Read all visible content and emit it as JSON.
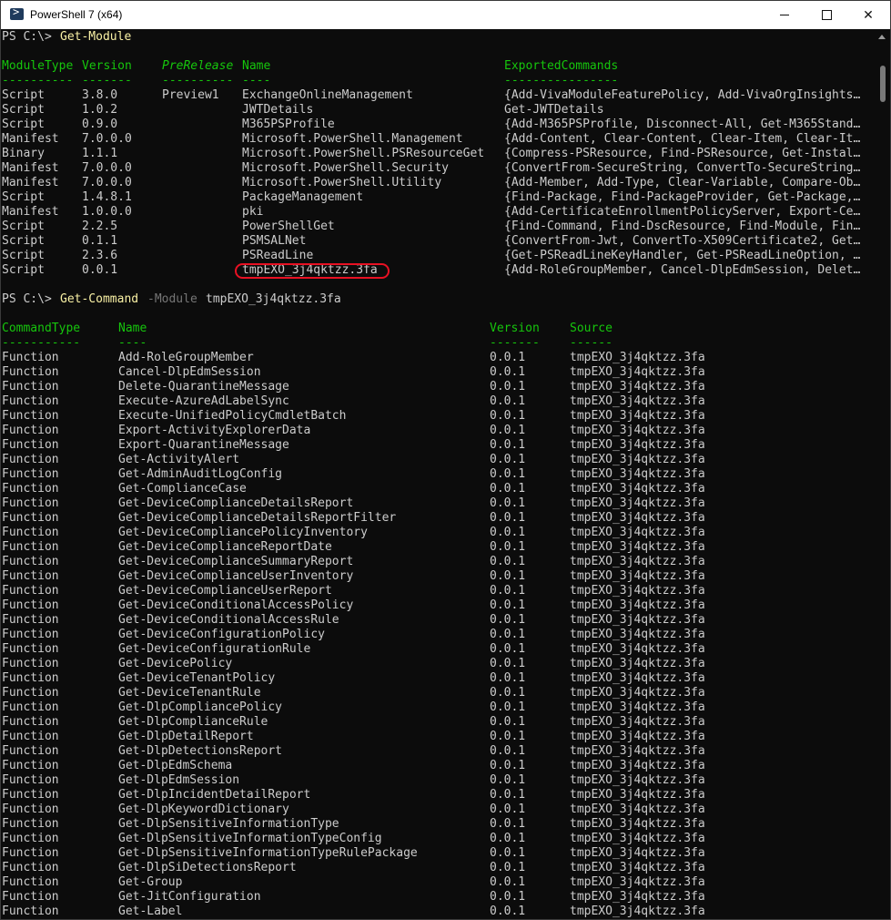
{
  "window": {
    "title": "PowerShell 7 (x64)"
  },
  "session": {
    "prompt": "PS C:\\> ",
    "command1": {
      "name": "Get-Module"
    },
    "command2": {
      "name": "Get-Command",
      "param": "-Module",
      "arg": "tmpEXO_3j4qktzz.3fa"
    }
  },
  "modules": {
    "headers": [
      "ModuleType",
      "Version",
      "PreRelease",
      "Name",
      "ExportedCommands"
    ],
    "underlines": [
      "----------",
      "-------",
      "----------",
      "----",
      "----------------"
    ],
    "rows": [
      [
        "Script",
        "3.8.0",
        "Preview1",
        "ExchangeOnlineManagement",
        "{Add-VivaModuleFeaturePolicy, Add-VivaOrgInsights…"
      ],
      [
        "Script",
        "1.0.2",
        "",
        "JWTDetails",
        "Get-JWTDetails"
      ],
      [
        "Script",
        "0.9.0",
        "",
        "M365PSProfile",
        "{Add-M365PSProfile, Disconnect-All, Get-M365Stand…"
      ],
      [
        "Manifest",
        "7.0.0.0",
        "",
        "Microsoft.PowerShell.Management",
        "{Add-Content, Clear-Content, Clear-Item, Clear-It…"
      ],
      [
        "Binary",
        "1.1.1",
        "",
        "Microsoft.PowerShell.PSResourceGet",
        "{Compress-PSResource, Find-PSResource, Get-Instal…"
      ],
      [
        "Manifest",
        "7.0.0.0",
        "",
        "Microsoft.PowerShell.Security",
        "{ConvertFrom-SecureString, ConvertTo-SecureString…"
      ],
      [
        "Manifest",
        "7.0.0.0",
        "",
        "Microsoft.PowerShell.Utility",
        "{Add-Member, Add-Type, Clear-Variable, Compare-Ob…"
      ],
      [
        "Script",
        "1.4.8.1",
        "",
        "PackageManagement",
        "{Find-Package, Find-PackageProvider, Get-Package,…"
      ],
      [
        "Manifest",
        "1.0.0.0",
        "",
        "pki",
        "{Add-CertificateEnrollmentPolicyServer, Export-Ce…"
      ],
      [
        "Script",
        "2.2.5",
        "",
        "PowerShellGet",
        "{Find-Command, Find-DscResource, Find-Module, Fin…"
      ],
      [
        "Script",
        "0.1.1",
        "",
        "PSMSALNet",
        "{ConvertFrom-Jwt, ConvertTo-X509Certificate2, Get…"
      ],
      [
        "Script",
        "2.3.6",
        "",
        "PSReadLine",
        "{Get-PSReadLineKeyHandler, Get-PSReadLineOption, …"
      ],
      [
        "Script",
        "0.0.1",
        "",
        "tmpEXO_3j4qktzz.3fa",
        "{Add-RoleGroupMember, Cancel-DlpEdmSession, Delet…"
      ]
    ]
  },
  "commands": {
    "headers": [
      "CommandType",
      "Name",
      "Version",
      "Source"
    ],
    "underlines": [
      "-----------",
      "----",
      "-------",
      "------"
    ],
    "type": "Function",
    "version": "0.0.1",
    "source": "tmpEXO_3j4qktzz.3fa",
    "names": [
      "Add-RoleGroupMember",
      "Cancel-DlpEdmSession",
      "Delete-QuarantineMessage",
      "Execute-AzureAdLabelSync",
      "Execute-UnifiedPolicyCmdletBatch",
      "Export-ActivityExplorerData",
      "Export-QuarantineMessage",
      "Get-ActivityAlert",
      "Get-AdminAuditLogConfig",
      "Get-ComplianceCase",
      "Get-DeviceComplianceDetailsReport",
      "Get-DeviceComplianceDetailsReportFilter",
      "Get-DeviceCompliancePolicyInventory",
      "Get-DeviceComplianceReportDate",
      "Get-DeviceComplianceSummaryReport",
      "Get-DeviceComplianceUserInventory",
      "Get-DeviceComplianceUserReport",
      "Get-DeviceConditionalAccessPolicy",
      "Get-DeviceConditionalAccessRule",
      "Get-DeviceConfigurationPolicy",
      "Get-DeviceConfigurationRule",
      "Get-DevicePolicy",
      "Get-DeviceTenantPolicy",
      "Get-DeviceTenantRule",
      "Get-DlpCompliancePolicy",
      "Get-DlpComplianceRule",
      "Get-DlpDetailReport",
      "Get-DlpDetectionsReport",
      "Get-DlpEdmSchema",
      "Get-DlpEdmSession",
      "Get-DlpIncidentDetailReport",
      "Get-DlpKeywordDictionary",
      "Get-DlpSensitiveInformationType",
      "Get-DlpSensitiveInformationTypeConfig",
      "Get-DlpSensitiveInformationTypeRulePackage",
      "Get-DlpSiDetectionsReport",
      "Get-Group",
      "Get-JitConfiguration",
      "Get-Label"
    ]
  },
  "colors": {
    "background": "#0c0c0c",
    "text": "#cccccc",
    "header": "#16c60c",
    "command": "#f9f1a5",
    "parameter": "#767676",
    "highlight_circle": "#e81123"
  },
  "icons": {
    "app": "powershell-icon",
    "minimize": "minimize-icon",
    "maximize": "maximize-icon",
    "close": "close-icon"
  }
}
